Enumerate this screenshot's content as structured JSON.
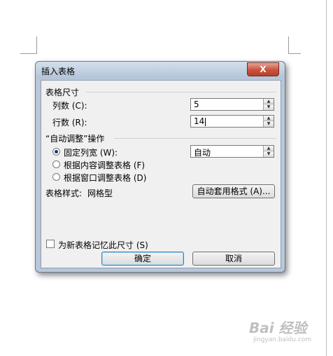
{
  "dialog": {
    "title": "插入表格",
    "close_label": "X",
    "table_size": {
      "section_label": "表格尺寸",
      "columns_label": "列数 (C):",
      "columns_value": "5",
      "rows_label": "行数 (R):",
      "rows_value": "14"
    },
    "autofit": {
      "section_label": "“自动调整”操作",
      "options": [
        {
          "label": "固定列宽 (W):",
          "checked": true
        },
        {
          "label": "根据内容调整表格 (F)",
          "checked": false
        },
        {
          "label": "根据窗口调整表格 (D)",
          "checked": false
        }
      ],
      "fixed_width_value": "自动"
    },
    "table_style": {
      "label": "表格样式:",
      "value": "网格型",
      "autoformat_button": "自动套用格式 (A)..."
    },
    "remember_checkbox": {
      "label": "为新表格记忆此尺寸 (S)",
      "checked": false
    },
    "ok_button": "确定",
    "cancel_button": "取消"
  },
  "watermark": {
    "main": "Bai 经验",
    "sub": "jingyan.baidu.com"
  },
  "colors": {
    "dialog_frame": "#b8c7d9",
    "content_bg": "#f0f0f0",
    "close_button": "#c8513b"
  }
}
